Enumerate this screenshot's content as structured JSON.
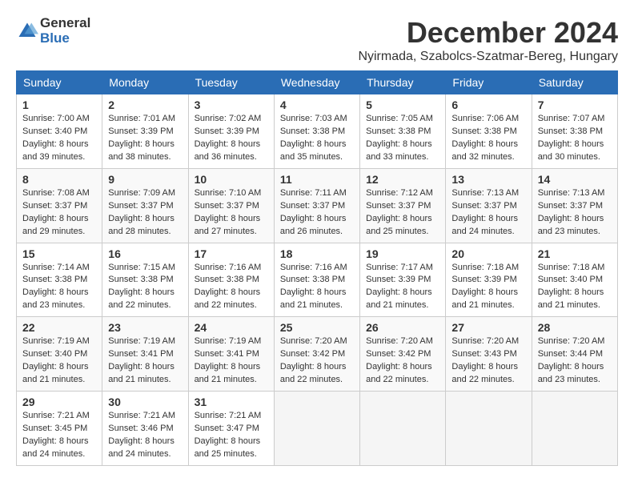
{
  "header": {
    "logo_general": "General",
    "logo_blue": "Blue",
    "title": "December 2024",
    "location": "Nyirmada, Szabolcs-Szatmar-Bereg, Hungary"
  },
  "days_of_week": [
    "Sunday",
    "Monday",
    "Tuesday",
    "Wednesday",
    "Thursday",
    "Friday",
    "Saturday"
  ],
  "weeks": [
    [
      {
        "day": 1,
        "sunrise": "7:00 AM",
        "sunset": "3:40 PM",
        "hours": 8,
        "minutes": 39
      },
      {
        "day": 2,
        "sunrise": "7:01 AM",
        "sunset": "3:39 PM",
        "hours": 8,
        "minutes": 38
      },
      {
        "day": 3,
        "sunrise": "7:02 AM",
        "sunset": "3:39 PM",
        "hours": 8,
        "minutes": 36
      },
      {
        "day": 4,
        "sunrise": "7:03 AM",
        "sunset": "3:38 PM",
        "hours": 8,
        "minutes": 35
      },
      {
        "day": 5,
        "sunrise": "7:05 AM",
        "sunset": "3:38 PM",
        "hours": 8,
        "minutes": 33
      },
      {
        "day": 6,
        "sunrise": "7:06 AM",
        "sunset": "3:38 PM",
        "hours": 8,
        "minutes": 32
      },
      {
        "day": 7,
        "sunrise": "7:07 AM",
        "sunset": "3:38 PM",
        "hours": 8,
        "minutes": 30
      }
    ],
    [
      {
        "day": 8,
        "sunrise": "7:08 AM",
        "sunset": "3:37 PM",
        "hours": 8,
        "minutes": 29
      },
      {
        "day": 9,
        "sunrise": "7:09 AM",
        "sunset": "3:37 PM",
        "hours": 8,
        "minutes": 28
      },
      {
        "day": 10,
        "sunrise": "7:10 AM",
        "sunset": "3:37 PM",
        "hours": 8,
        "minutes": 27
      },
      {
        "day": 11,
        "sunrise": "7:11 AM",
        "sunset": "3:37 PM",
        "hours": 8,
        "minutes": 26
      },
      {
        "day": 12,
        "sunrise": "7:12 AM",
        "sunset": "3:37 PM",
        "hours": 8,
        "minutes": 25
      },
      {
        "day": 13,
        "sunrise": "7:13 AM",
        "sunset": "3:37 PM",
        "hours": 8,
        "minutes": 24
      },
      {
        "day": 14,
        "sunrise": "7:13 AM",
        "sunset": "3:37 PM",
        "hours": 8,
        "minutes": 23
      }
    ],
    [
      {
        "day": 15,
        "sunrise": "7:14 AM",
        "sunset": "3:38 PM",
        "hours": 8,
        "minutes": 23
      },
      {
        "day": 16,
        "sunrise": "7:15 AM",
        "sunset": "3:38 PM",
        "hours": 8,
        "minutes": 22
      },
      {
        "day": 17,
        "sunrise": "7:16 AM",
        "sunset": "3:38 PM",
        "hours": 8,
        "minutes": 22
      },
      {
        "day": 18,
        "sunrise": "7:16 AM",
        "sunset": "3:38 PM",
        "hours": 8,
        "minutes": 21
      },
      {
        "day": 19,
        "sunrise": "7:17 AM",
        "sunset": "3:39 PM",
        "hours": 8,
        "minutes": 21
      },
      {
        "day": 20,
        "sunrise": "7:18 AM",
        "sunset": "3:39 PM",
        "hours": 8,
        "minutes": 21
      },
      {
        "day": 21,
        "sunrise": "7:18 AM",
        "sunset": "3:40 PM",
        "hours": 8,
        "minutes": 21
      }
    ],
    [
      {
        "day": 22,
        "sunrise": "7:19 AM",
        "sunset": "3:40 PM",
        "hours": 8,
        "minutes": 21
      },
      {
        "day": 23,
        "sunrise": "7:19 AM",
        "sunset": "3:41 PM",
        "hours": 8,
        "minutes": 21
      },
      {
        "day": 24,
        "sunrise": "7:19 AM",
        "sunset": "3:41 PM",
        "hours": 8,
        "minutes": 21
      },
      {
        "day": 25,
        "sunrise": "7:20 AM",
        "sunset": "3:42 PM",
        "hours": 8,
        "minutes": 22
      },
      {
        "day": 26,
        "sunrise": "7:20 AM",
        "sunset": "3:42 PM",
        "hours": 8,
        "minutes": 22
      },
      {
        "day": 27,
        "sunrise": "7:20 AM",
        "sunset": "3:43 PM",
        "hours": 8,
        "minutes": 22
      },
      {
        "day": 28,
        "sunrise": "7:20 AM",
        "sunset": "3:44 PM",
        "hours": 8,
        "minutes": 23
      }
    ],
    [
      {
        "day": 29,
        "sunrise": "7:21 AM",
        "sunset": "3:45 PM",
        "hours": 8,
        "minutes": 24
      },
      {
        "day": 30,
        "sunrise": "7:21 AM",
        "sunset": "3:46 PM",
        "hours": 8,
        "minutes": 24
      },
      {
        "day": 31,
        "sunrise": "7:21 AM",
        "sunset": "3:47 PM",
        "hours": 8,
        "minutes": 25
      },
      null,
      null,
      null,
      null
    ]
  ],
  "labels": {
    "sunrise": "Sunrise:",
    "sunset": "Sunset:",
    "daylight": "Daylight:",
    "hours_label": "hours",
    "minutes_label": "minutes."
  }
}
